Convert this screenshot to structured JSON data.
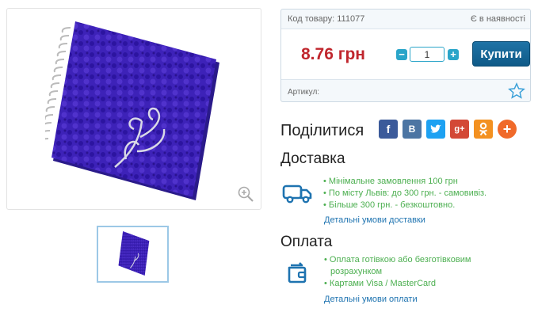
{
  "product": {
    "code_label": "Код товару: 111077",
    "stock": "Є в наявності",
    "price": "8.76 грн",
    "quantity": "1",
    "buy_label": "Купити",
    "article_label": "Артикул:"
  },
  "share": {
    "title": "Поділитися",
    "buttons": [
      "f",
      "B",
      "t",
      "g+",
      "ok",
      "+"
    ]
  },
  "delivery": {
    "title": "Доставка",
    "items": [
      "• Мінімальне замовлення 100 грн",
      "• По місту Львів: до 300 грн. - самовивіз.",
      "• Більше 300 грн. - безкоштовно."
    ],
    "link": "Детальні умови доставки"
  },
  "payment": {
    "title": "Оплата",
    "items": [
      "• Оплата готівкою або безготівковим",
      "розрахунком",
      "• Картами Visa / MasterCard"
    ],
    "link": "Детальні умови оплати"
  },
  "colors": {
    "price": "#c0262d",
    "buy_button": "#1f73a6",
    "accent": "#2aa5c9",
    "list_text": "#4caf50",
    "link": "#1e73b0"
  }
}
